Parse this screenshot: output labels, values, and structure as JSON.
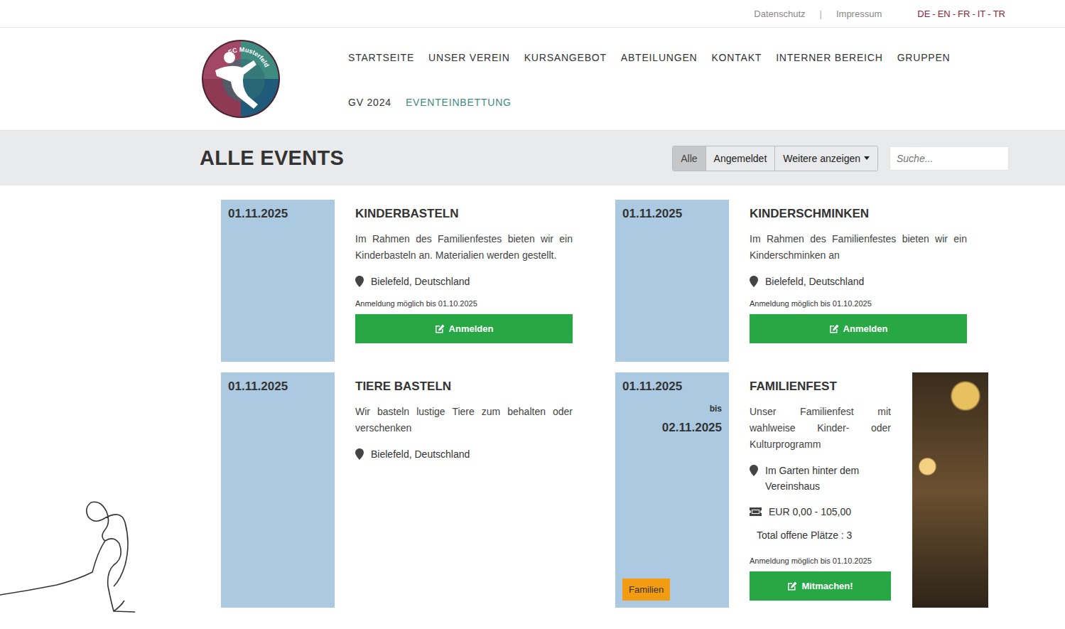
{
  "topbar": {
    "links": [
      "Datenschutz",
      "Impressum"
    ],
    "separator": "|",
    "languages": [
      "DE",
      "EN",
      "FR",
      "IT",
      "TR"
    ],
    "language_separator": "-"
  },
  "logo": {
    "text": "FC Musterfeld"
  },
  "nav": [
    {
      "label": "STARTSEITE",
      "selected": false
    },
    {
      "label": "UNSER VEREIN",
      "selected": false
    },
    {
      "label": "KURSANGEBOT",
      "selected": false
    },
    {
      "label": "ABTEILUNGEN",
      "selected": false
    },
    {
      "label": "KONTAKT",
      "selected": false
    },
    {
      "label": "INTERNER BEREICH",
      "selected": false
    },
    {
      "label": "GRUPPEN",
      "selected": false
    },
    {
      "label": "GV 2024",
      "selected": false
    },
    {
      "label": "EVENTEINBETTUNG",
      "selected": true
    }
  ],
  "page": {
    "title": "ALLE EVENTS"
  },
  "filters": [
    {
      "label": "Alle",
      "selected": true,
      "kind": "button"
    },
    {
      "label": "Angemeldet",
      "selected": false,
      "kind": "button"
    },
    {
      "label": "Weitere anzeigen",
      "selected": false,
      "kind": "dropdown"
    }
  ],
  "search": {
    "placeholder": "Suche..."
  },
  "events": [
    {
      "start_date": "01.11.2025",
      "title": "KINDERBASTELN",
      "description": "Im Rahmen des Familienfestes bieten wir ein Kinderbasteln an. Materialien werden gestellt.",
      "location": "Bielefeld, Deutschland",
      "deadline": "Anmeldung möglich bis 01.10.2025",
      "button": "Anmelden",
      "image": false
    },
    {
      "start_date": "01.11.2025",
      "title": "KINDERSCHMINKEN",
      "description": "Im Rahmen des Familienfestes bieten wir ein Kinderschminken an",
      "location": "Bielefeld, Deutschland",
      "deadline": "Anmeldung möglich bis 01.10.2025",
      "button": "Anmelden",
      "image": false
    },
    {
      "start_date": "01.11.2025",
      "title": "TIERE BASTELN",
      "description": "Wir basteln lustige Tiere zum behalten oder verschenken",
      "location": "Bielefeld, Deutschland",
      "image": false
    },
    {
      "start_date": "01.11.2025",
      "until": "bis",
      "end_date": "02.11.2025",
      "title": "FAMILIENFEST",
      "description": "Unser Familienfest mit wahlweise Kinder- oder Kulturprogramm",
      "location": "Im Garten hinter dem Vereinshaus",
      "price": "EUR 0,00 - 105,00",
      "spots": "Total offene Plätze : 3",
      "deadline": "Anmeldung möglich bis 01.10.2025",
      "button": "Mitmachen!",
      "tag": {
        "label": "Familien",
        "color": "#f39c12"
      },
      "image": true
    }
  ]
}
